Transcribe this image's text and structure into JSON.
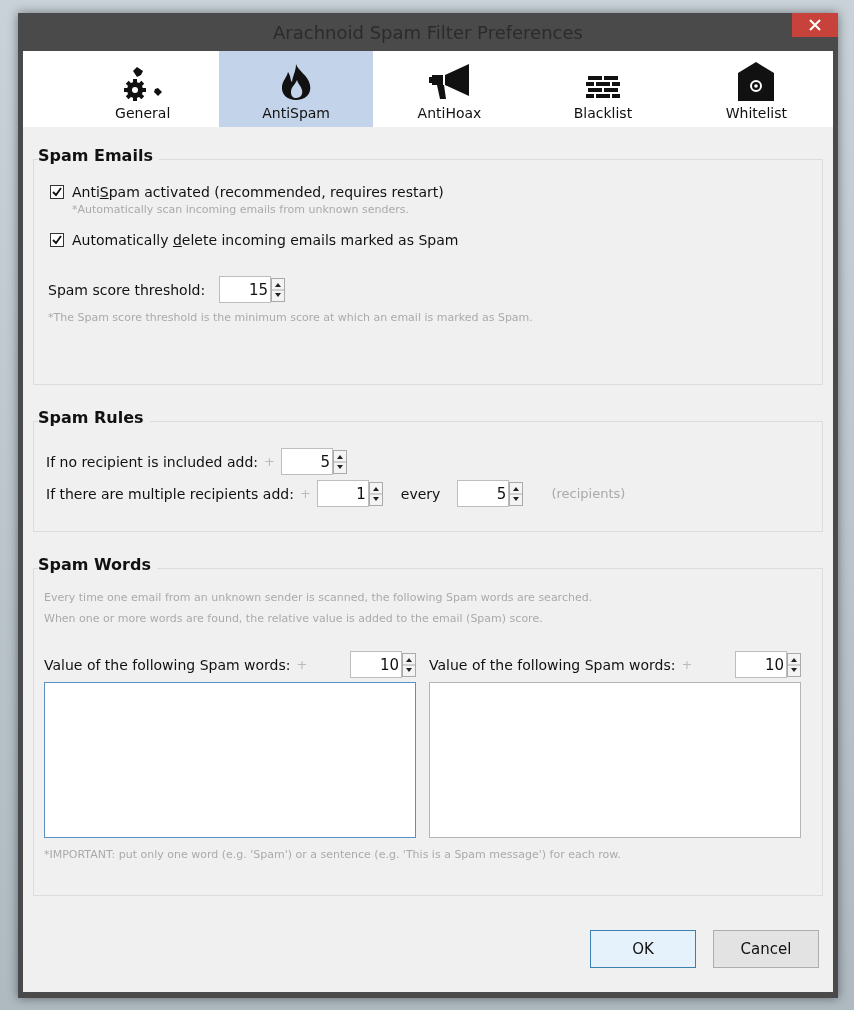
{
  "window": {
    "title": "Arachnoid Spam Filter Preferences"
  },
  "tabs": [
    {
      "label": "General",
      "kind": "tools",
      "selected": false
    },
    {
      "label": "AntiSpam",
      "kind": "flame",
      "selected": true
    },
    {
      "label": "AntiHoax",
      "kind": "megaphone",
      "selected": false
    },
    {
      "label": "Blacklist",
      "kind": "wall",
      "selected": false
    },
    {
      "label": "Whitelist",
      "kind": "envelope",
      "selected": false
    }
  ],
  "spam_emails": {
    "title": "Spam Emails",
    "options": [
      {
        "label_parts": [
          "Anti",
          "S",
          "pam activated (recommended, requires restart)"
        ],
        "checked": true,
        "note": "*Automatically scan incoming emails from unknown senders."
      },
      {
        "label_parts": [
          "Automatically ",
          "d",
          "elete incoming emails marked as Spam"
        ],
        "checked": true
      }
    ],
    "threshold": {
      "label": "Spam score threshold:",
      "value": "15"
    },
    "note": "*The Spam score threshold is the minimum score at which an email is marked as Spam."
  },
  "spam_rules": {
    "title": "Spam Rules",
    "rows": [
      {
        "label": "If no recipient is included add:",
        "plus": "+",
        "value": "5"
      },
      {
        "label": "If there are multiple recipients add:",
        "plus": "+",
        "value": "1",
        "every_label": "every",
        "every_value": "5",
        "unit": "(recipients)"
      }
    ]
  },
  "spam_words": {
    "title": "Spam Words",
    "description": [
      "Every time one email from an unknown sender is scanned, the following Spam words are searched.",
      "When one or more words are found, the relative value is added to the email (Spam) score."
    ],
    "lists": [
      {
        "label": "Value of the following Spam words:",
        "plus": "+",
        "value": "10",
        "focused": true
      },
      {
        "label": "Value of the following Spam words:",
        "plus": "+",
        "value": "10",
        "focused": false
      }
    ],
    "note": "*IMPORTANT: put only one word (e.g. 'Spam') or a sentence (e.g. 'This is a Spam message') for each row."
  },
  "buttons": [
    {
      "label": "OK",
      "default": true
    },
    {
      "label": "Cancel",
      "default": false
    }
  ]
}
